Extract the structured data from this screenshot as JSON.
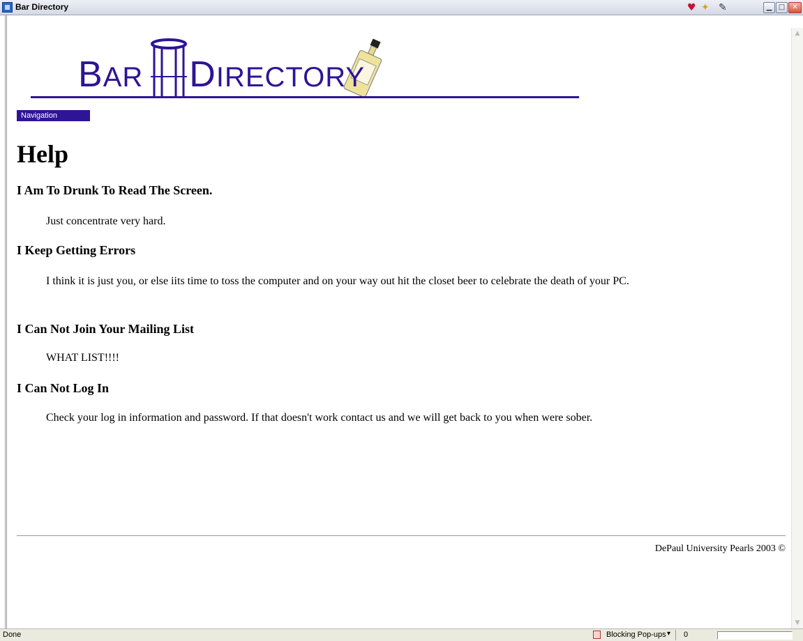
{
  "window": {
    "title": "Bar Directory",
    "icons": [
      "heart-icon",
      "star-add-icon",
      "edit-icon",
      "minimize-icon",
      "maximize-icon",
      "close-icon"
    ],
    "minimize_glyph": "▁",
    "maximize_glyph": "□",
    "close_glyph": "✕"
  },
  "logo": {
    "word1_initial": "B",
    "word1_rest": "AR",
    "word2_initial": "D",
    "word2_rest": "IRECTORY",
    "brand_color": "#2e1496"
  },
  "nav": {
    "label": "Navigation"
  },
  "page": {
    "heading": "Help",
    "faq": [
      {
        "question": "I Am To Drunk To Read The Screen.",
        "answer": "Just concentrate very hard."
      },
      {
        "question": "I Keep Getting Errors",
        "answer": "I think it is just you, or else iits time to toss the computer and on your way out hit the closet beer to celebrate the death of your PC."
      },
      {
        "question": "I Can Not Join Your Mailing List",
        "answer": "WHAT LIST!!!!"
      },
      {
        "question": "I Can Not Log In",
        "answer": "Check your log in information and password. If that doesn't work contact us and we will get back to you when were sober."
      }
    ]
  },
  "footer": {
    "text": "DePaul University Pearls 2003 ©"
  },
  "statusbar": {
    "status": "Done",
    "popup_blocker": "Blocking Pop-ups",
    "popup_arrow": "▾",
    "count": "0"
  }
}
